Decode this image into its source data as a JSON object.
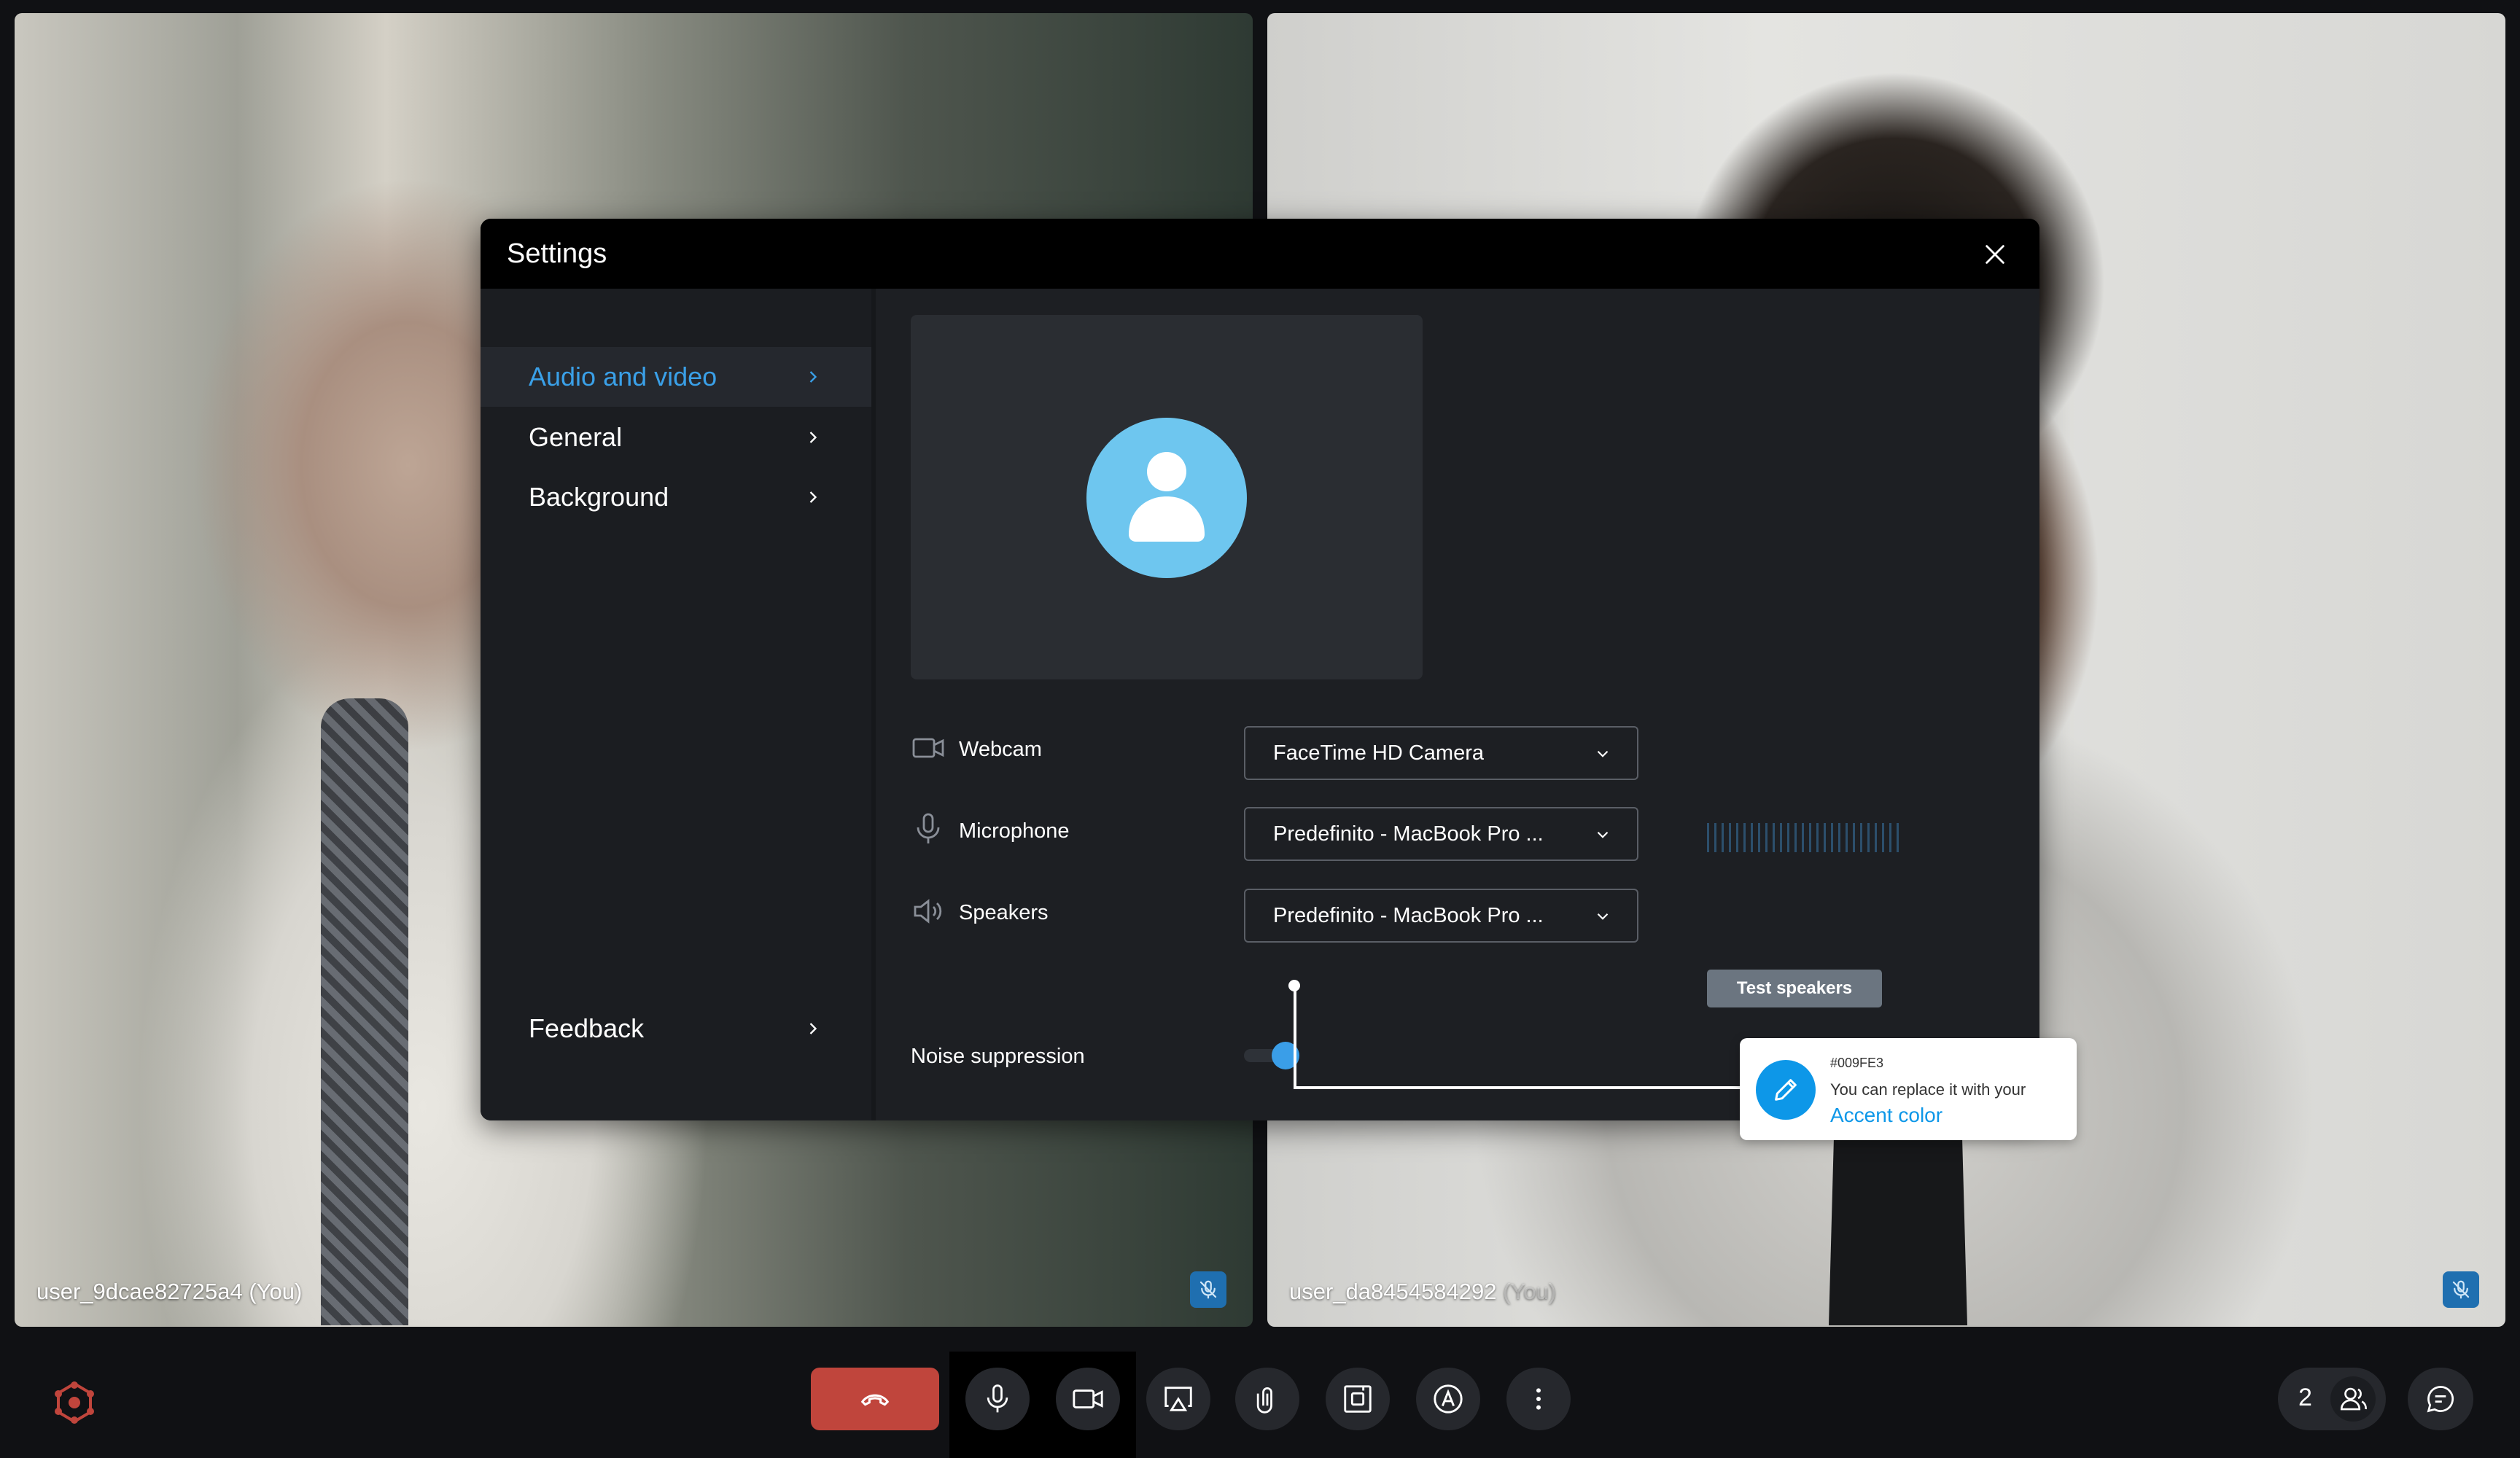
{
  "tiles": [
    {
      "name": "user_9dcae82725a4",
      "you": "(You)"
    },
    {
      "name": "user_da8454584292",
      "you": "(You)"
    }
  ],
  "settings": {
    "title": "Settings",
    "nav": [
      {
        "label": "Audio and video",
        "active": true
      },
      {
        "label": "General"
      },
      {
        "label": "Background"
      },
      {
        "label": "Feedback"
      }
    ],
    "webcam": {
      "label": "Webcam",
      "value": "FaceTime HD Camera"
    },
    "microphone": {
      "label": "Microphone",
      "value": "Predefinito - MacBook Pro ..."
    },
    "speakers": {
      "label": "Speakers",
      "value": "Predefinito - MacBook Pro ...",
      "test_label": "Test speakers"
    },
    "noise_suppression": {
      "label": "Noise suppression",
      "enabled": true
    }
  },
  "callout": {
    "hex": "#009FE3",
    "text": "You can replace it with your",
    "link": "Accent color"
  },
  "toolbar": {
    "participants_count": "2"
  },
  "colors": {
    "accent": "#009FE3",
    "end_call": "#C0453C",
    "modal_bg": "#1D1F23",
    "active_nav": "#3AA0E8"
  }
}
